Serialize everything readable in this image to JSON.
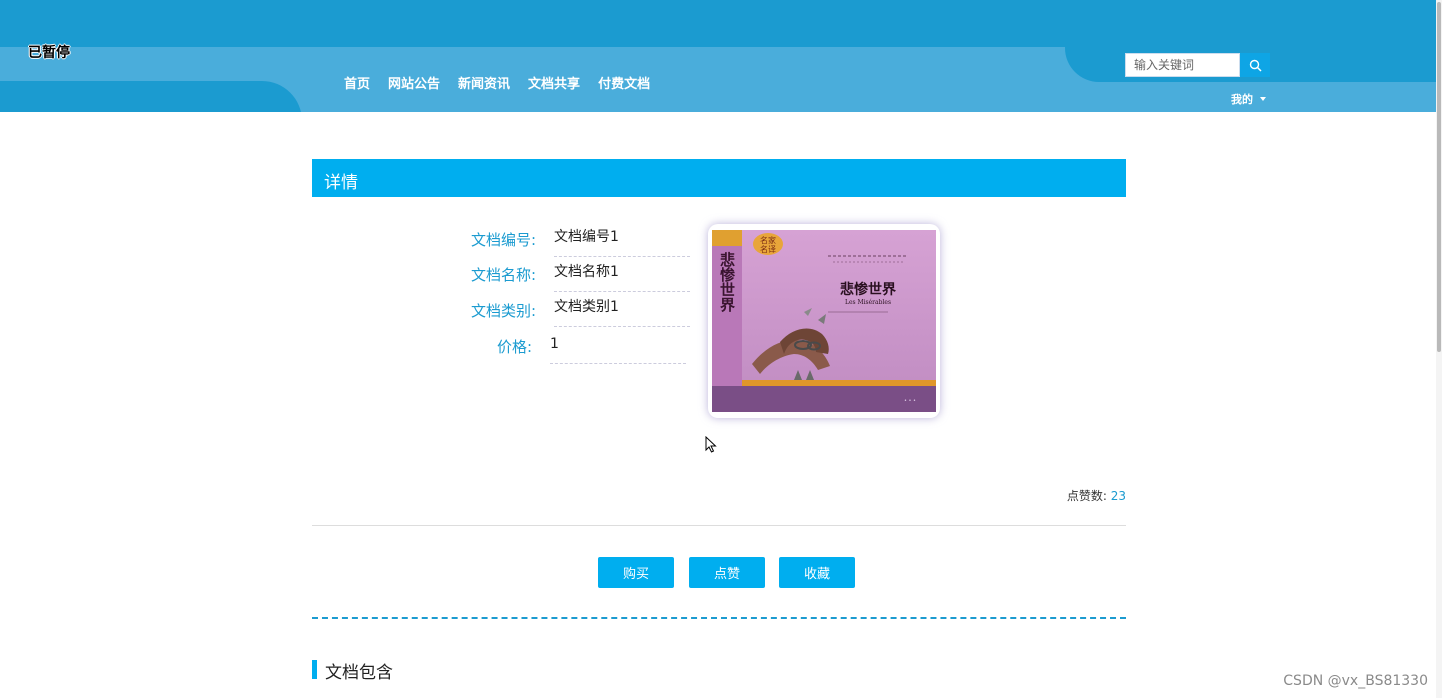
{
  "overlay": {
    "status": "已暂停"
  },
  "nav": {
    "items": [
      "首页",
      "网站公告",
      "新闻资讯",
      "文档共享",
      "付费文档"
    ]
  },
  "search": {
    "placeholder": "输入关键词"
  },
  "user_menu": {
    "label": "我的"
  },
  "detail": {
    "title": "详情",
    "fields": [
      {
        "label": "文档编号:",
        "value": "文档编号1"
      },
      {
        "label": "文档名称:",
        "value": "文档名称1"
      },
      {
        "label": "文档类别:",
        "value": "文档类别1"
      },
      {
        "label": "价格:",
        "value": "1"
      }
    ],
    "cover": {
      "title": "悲惨世界",
      "subtitle": "Les Misérables",
      "badge_line1": "名家",
      "badge_line2": "名译"
    },
    "likes_label": "点赞数:",
    "likes_count": "23"
  },
  "actions": {
    "buy": "购买",
    "like": "点赞",
    "favorite": "收藏"
  },
  "contains_section": {
    "title": "文档包含"
  },
  "watermark": "CSDN @vx_BS81330",
  "colors": {
    "header": "#1b9bd0",
    "header_band": "#4aaddb",
    "accent": "#00aeef",
    "label": "#1b9bd0"
  }
}
